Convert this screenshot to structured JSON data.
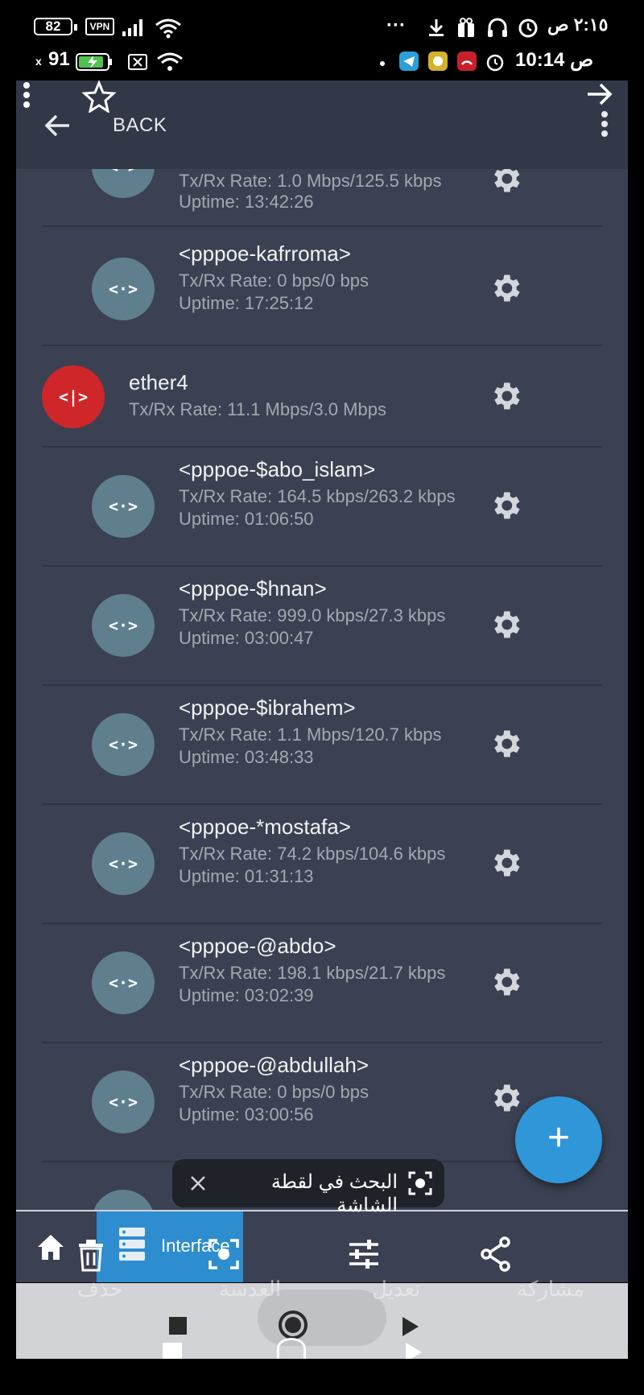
{
  "status_bar_top": {
    "battery": "82",
    "vpn": "VPN",
    "time": "٢:١٥ ص",
    "more": "···"
  },
  "status_bar_second": {
    "battery": "91",
    "battery_x": "x",
    "time": "10:14 ص"
  },
  "toolbar": {
    "back_label": "BACK"
  },
  "list": [
    {
      "kind": "child",
      "title": "",
      "rate": "Tx/Rx Rate: 1.0 Mbps/125.5 kbps",
      "uptime": "Uptime: 13:42:26"
    },
    {
      "kind": "child",
      "title": "<pppoe-kafrroma>",
      "rate": "Tx/Rx Rate: 0 bps/0 bps",
      "uptime": "Uptime: 17:25:12"
    },
    {
      "kind": "ether",
      "title": "ether4",
      "rate": "Tx/Rx Rate: 11.1 Mbps/3.0 Mbps",
      "uptime": ""
    },
    {
      "kind": "child",
      "title": "<pppoe-$abo_islam>",
      "rate": "Tx/Rx Rate: 164.5 kbps/263.2 kbps",
      "uptime": "Uptime: 01:06:50"
    },
    {
      "kind": "child",
      "title": "<pppoe-$hnan>",
      "rate": "Tx/Rx Rate: 999.0 kbps/27.3 kbps",
      "uptime": "Uptime: 03:00:47"
    },
    {
      "kind": "child",
      "title": "<pppoe-$ibrahem>",
      "rate": "Tx/Rx Rate: 1.1 Mbps/120.7 kbps",
      "uptime": "Uptime: 03:48:33"
    },
    {
      "kind": "child",
      "title": "<pppoe-*mostafa>",
      "rate": "Tx/Rx Rate: 74.2 kbps/104.6 kbps",
      "uptime": "Uptime: 01:31:13"
    },
    {
      "kind": "child",
      "title": "<pppoe-@abdo>",
      "rate": "Tx/Rx Rate: 198.1 kbps/21.7 kbps",
      "uptime": "Uptime: 03:02:39"
    },
    {
      "kind": "child",
      "title": "<pppoe-@abdullah>",
      "rate": "Tx/Rx Rate: 0 bps/0 bps",
      "uptime": "Uptime: 03:00:56"
    }
  ],
  "fab": {
    "label": "+"
  },
  "lens_toast": {
    "text": "البحث في لقطة الشاشة"
  },
  "bottom_nav": {
    "active_label": "Interface"
  },
  "action_bar": {
    "delete": "حذف",
    "lens": "العدسة",
    "edit": "تعديل",
    "share": "مشاركة"
  },
  "colors": {
    "app_bg": "#3b4152",
    "toolbar_bg": "#323848",
    "avatar": "#5f7f8e",
    "ether_avatar": "#cf2629",
    "fab": "#2f96d8",
    "nav_active": "#2d8dce"
  }
}
